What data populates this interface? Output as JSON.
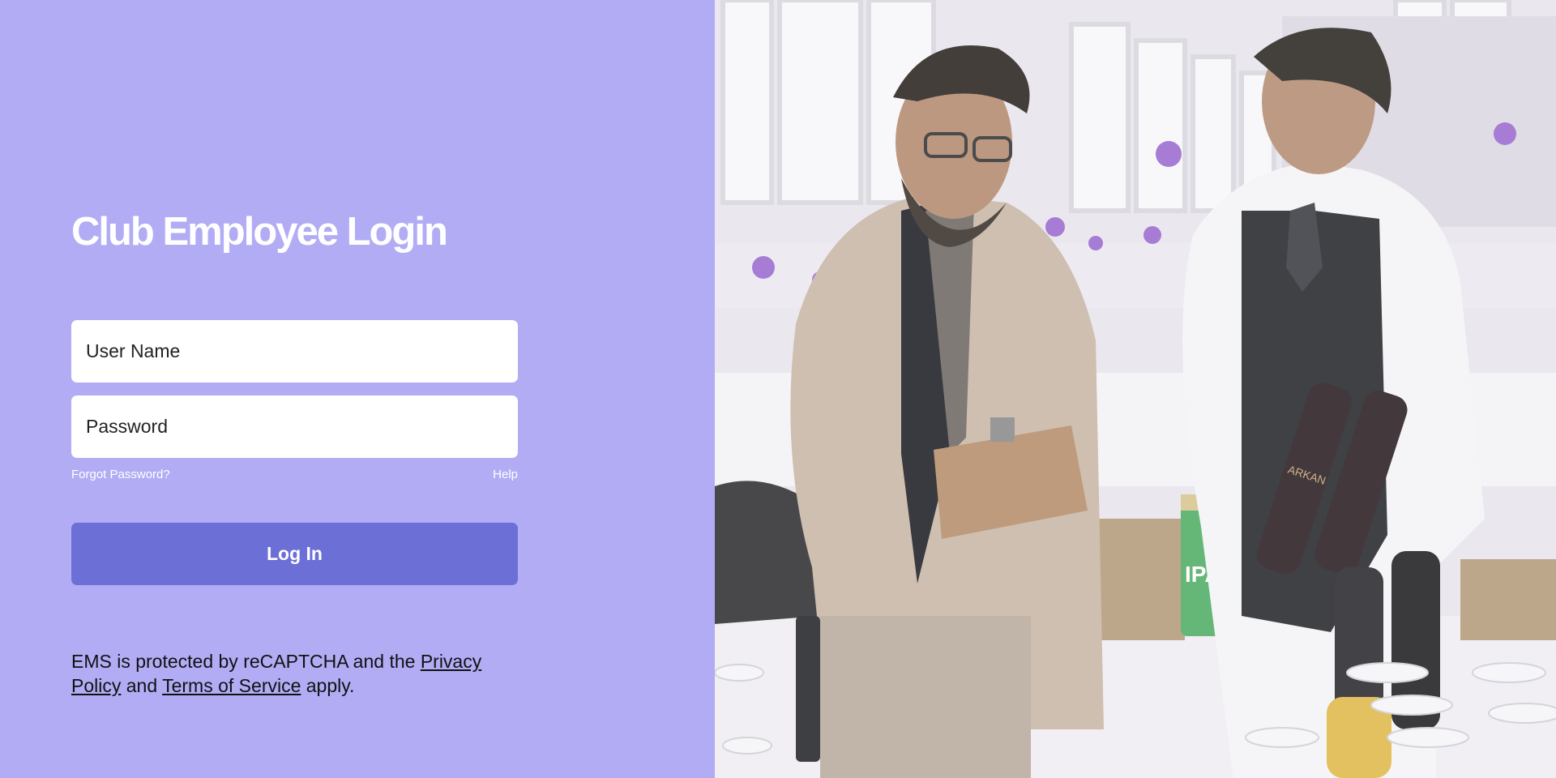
{
  "login": {
    "title": "Club Employee Login",
    "username_placeholder": "User Name",
    "password_placeholder": "Password",
    "forgot_password": "Forgot Password?",
    "help": "Help",
    "login_button": "Log In"
  },
  "recaptcha": {
    "prefix": "EMS is protected by reCAPTCHA and the ",
    "privacy_link": "Privacy Policy",
    "middle": " and ",
    "terms_link": "Terms of Service",
    "suffix": " apply."
  },
  "photo": {
    "ipa_label": "IPA",
    "bottle_label": "ARKAN"
  },
  "colors": {
    "panel_bg": "#b2acf5",
    "button_bg": "#6b6fd6",
    "field_bg": "#ffffff"
  }
}
